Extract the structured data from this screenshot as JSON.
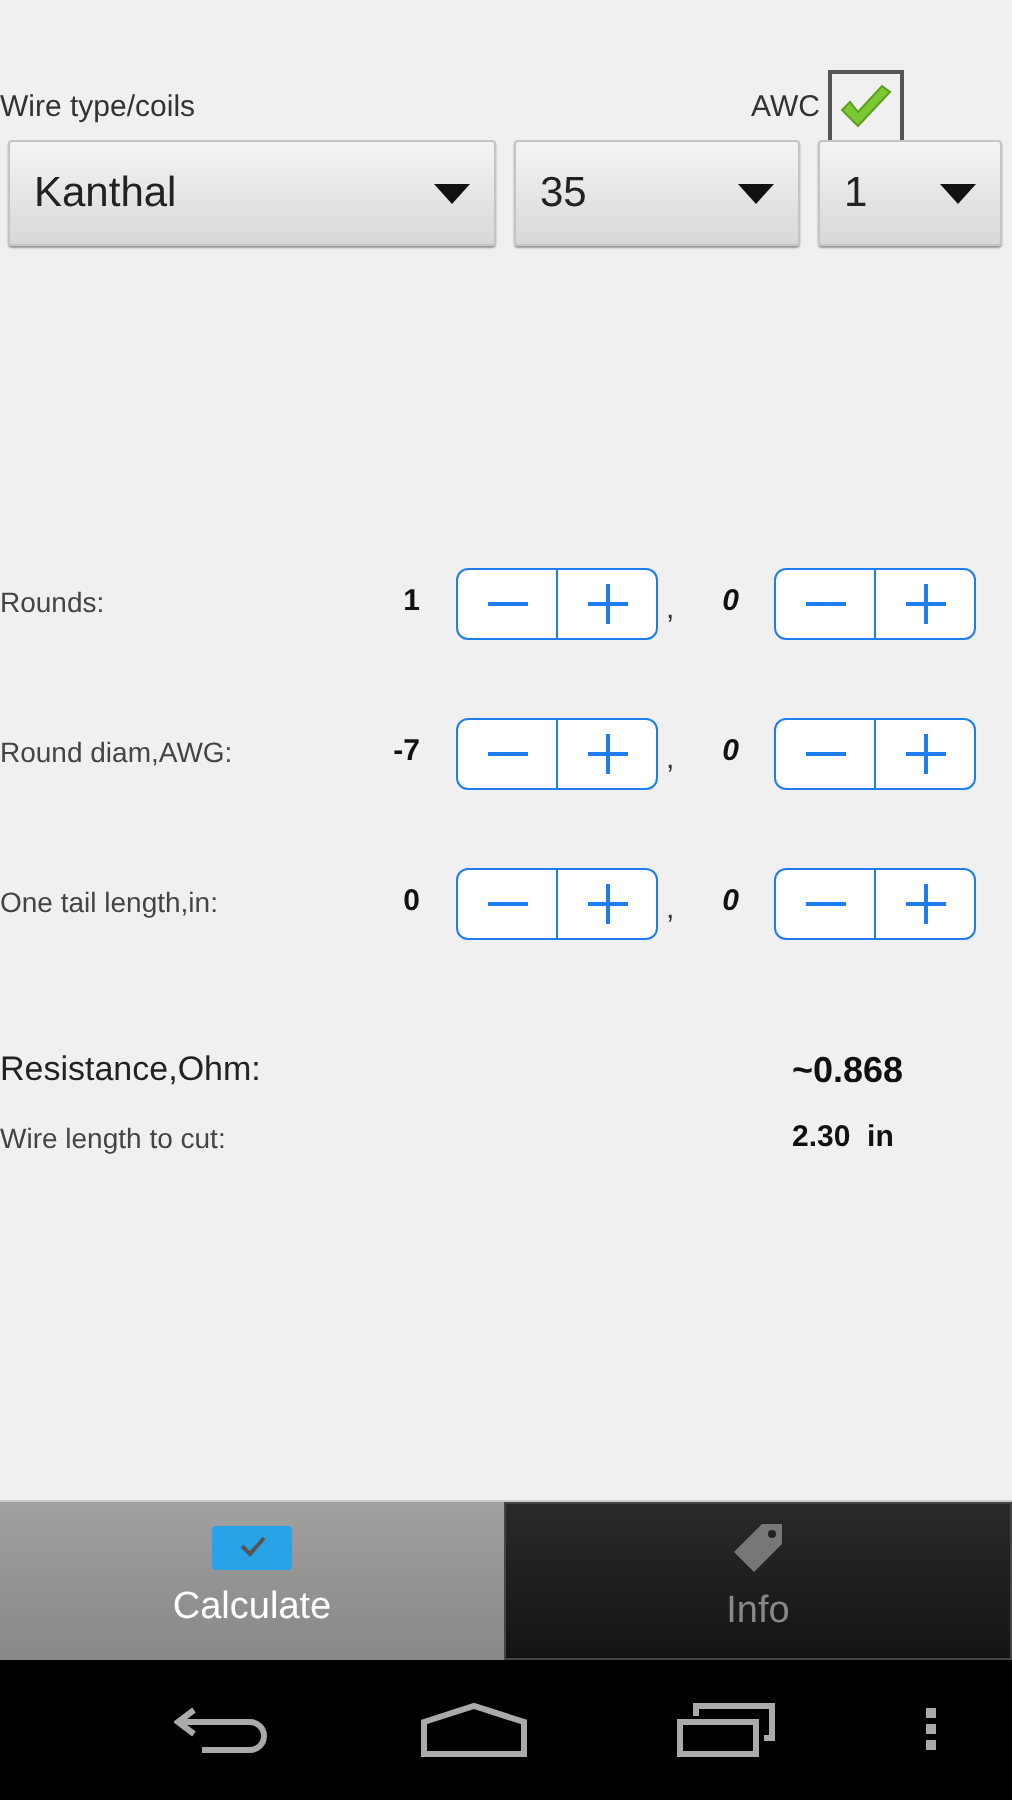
{
  "header": {
    "label": "Wire type/coils",
    "awc_label": "AWC",
    "awc_checked": true
  },
  "dropdowns": [
    {
      "value": "Kanthal"
    },
    {
      "value": "35"
    },
    {
      "value": "1"
    }
  ],
  "steppers": [
    {
      "label": "Rounds:",
      "whole": "1",
      "separator": ",",
      "fraction": "0"
    },
    {
      "label": "Round diam,AWG:",
      "whole": "-7",
      "separator": ",",
      "fraction": "0"
    },
    {
      "label": "One tail length,in:",
      "whole": "0",
      "separator": ",",
      "fraction": "0"
    }
  ],
  "results": [
    {
      "label": "Resistance,Ohm:",
      "value": "~0.868",
      "kind": "main"
    },
    {
      "label": "Wire length to cut:",
      "value": "2.30  in",
      "kind": "secondary"
    }
  ],
  "tabs": [
    {
      "label": "Calculate",
      "selected": true,
      "kind": "calculate"
    },
    {
      "label": "Info",
      "selected": false,
      "kind": "info"
    }
  ]
}
